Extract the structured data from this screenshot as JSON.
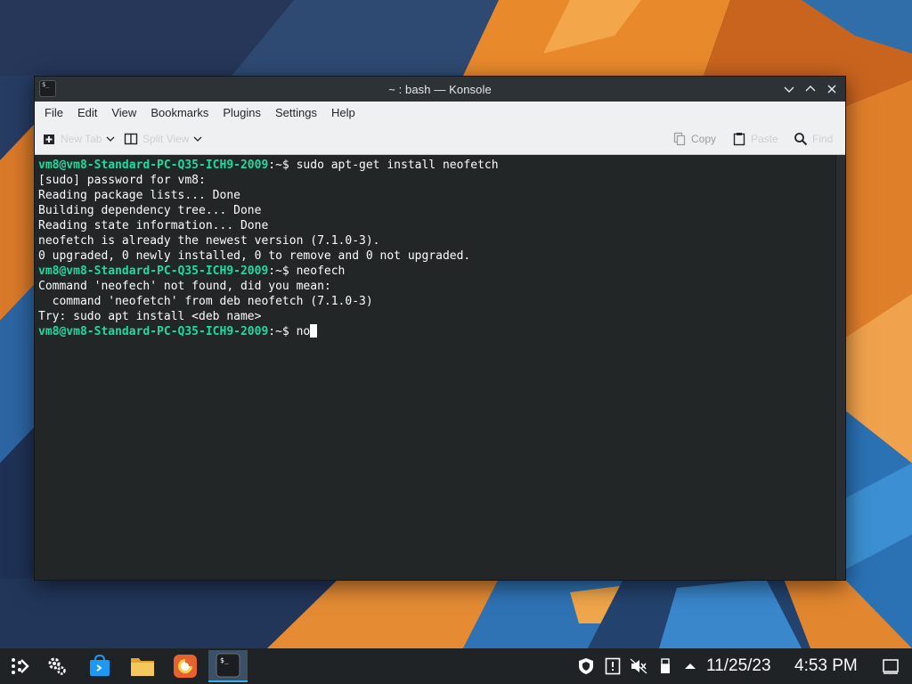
{
  "window": {
    "title": "~ : bash — Konsole"
  },
  "menubar": {
    "items": [
      "File",
      "Edit",
      "View",
      "Bookmarks",
      "Plugins",
      "Settings",
      "Help"
    ]
  },
  "toolbar": {
    "new_tab_label": "New Tab",
    "split_view_label": "Split View",
    "copy_label": "Copy",
    "paste_label": "Paste",
    "find_label": "Find"
  },
  "terminal": {
    "prompt_user": "vm8@vm8-Standard-PC-Q35-ICH9-2009",
    "prompt_suffix": ":~$ ",
    "lines": [
      {
        "type": "prompt",
        "command": "sudo apt-get install neofetch"
      },
      {
        "type": "output",
        "text": "[sudo] password for vm8:"
      },
      {
        "type": "output",
        "text": "Reading package lists... Done"
      },
      {
        "type": "output",
        "text": "Building dependency tree... Done"
      },
      {
        "type": "output",
        "text": "Reading state information... Done"
      },
      {
        "type": "output",
        "text": "neofetch is already the newest version (7.1.0-3)."
      },
      {
        "type": "output",
        "text": "0 upgraded, 0 newly installed, 0 to remove and 0 not upgraded."
      },
      {
        "type": "prompt",
        "command": "neofech"
      },
      {
        "type": "output",
        "text": "Command 'neofech' not found, did you mean:"
      },
      {
        "type": "output",
        "text": "  command 'neofetch' from deb neofetch (7.1.0-3)"
      },
      {
        "type": "output",
        "text": "Try: sudo apt install <deb name>"
      },
      {
        "type": "prompt",
        "command": "no",
        "cursor": true
      }
    ]
  },
  "taskbar": {
    "date": "11/25/23",
    "time": "4:53 PM",
    "apps": [
      "application-launcher-icon",
      "system-settings-icon",
      "discover-icon",
      "file-manager-icon",
      "firefox-icon",
      "konsole-icon"
    ],
    "tray": [
      "security-shield-icon",
      "notifications-icon",
      "volume-muted-icon",
      "usb-device-icon",
      "tray-expand-icon"
    ]
  },
  "colors": {
    "accent": "#3daee9",
    "prompt": "#1cdc9a",
    "terminal_bg": "#232627",
    "taskbar_bg": "#202326"
  }
}
